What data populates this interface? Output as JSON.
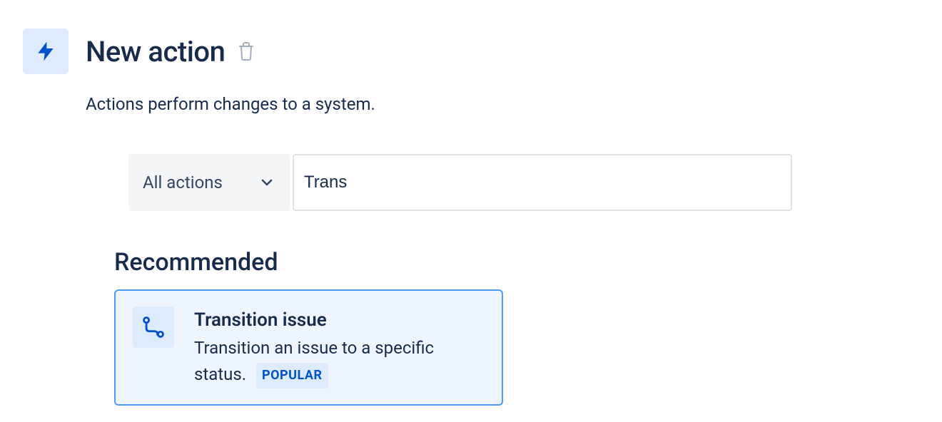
{
  "header": {
    "title": "New action",
    "description": "Actions perform changes to a system."
  },
  "filter": {
    "dropdown_label": "All actions",
    "search_value": "Trans"
  },
  "section": {
    "heading": "Recommended"
  },
  "card": {
    "title": "Transition issue",
    "description": "Transition an issue to a specific status.",
    "badge": "POPULAR"
  }
}
